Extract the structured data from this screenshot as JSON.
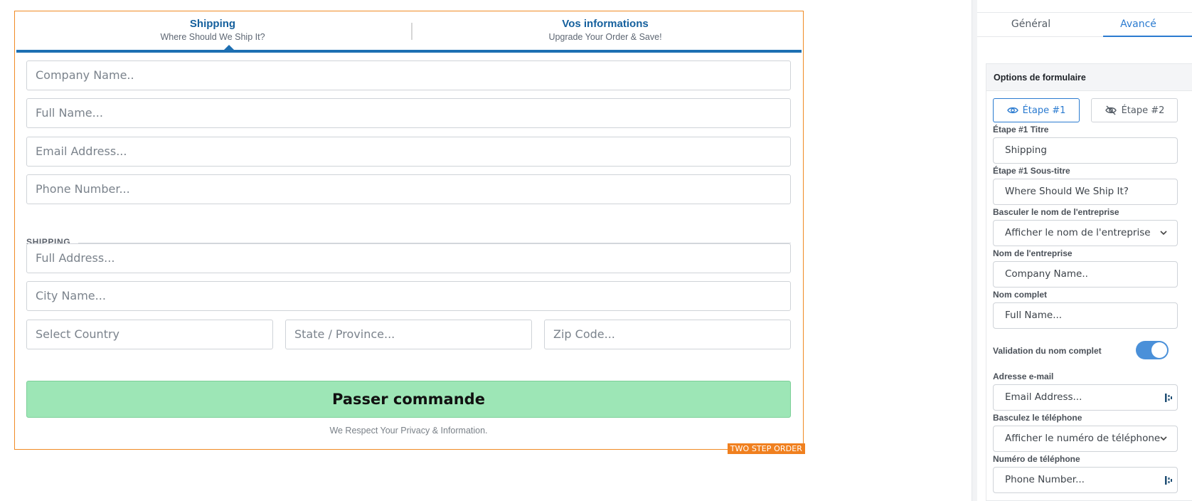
{
  "form": {
    "badge": "TWO STEP ORDER",
    "steps": [
      {
        "title": "Shipping",
        "subtitle": "Where Should We Ship It?"
      },
      {
        "title": "Vos informations",
        "subtitle": "Upgrade Your Order & Save!"
      }
    ],
    "fields": {
      "company": "Company Name..",
      "full_name": "Full Name...",
      "email": "Email Address...",
      "phone": "Phone Number...",
      "address": "Full Address...",
      "city": "City Name...",
      "country": "Select Country",
      "state": "State / Province...",
      "zip": "Zip Code..."
    },
    "section_label": "SHIPPING",
    "submit_label": "Passer commande",
    "privacy_text": "We Respect Your Privacy & Information.",
    "colors": {
      "accent": "#1d6fb2",
      "frame": "#f08a24",
      "submit": "#9de6b6"
    }
  },
  "panel": {
    "tabs": [
      "Général",
      "Avancé"
    ],
    "active_tab": "Avancé",
    "section_title": "Options de formulaire",
    "step_buttons": [
      {
        "label": "Étape #1",
        "icon": "eye-icon",
        "active": true
      },
      {
        "label": "Étape #2",
        "icon": "eye-slash-icon",
        "active": false
      }
    ],
    "step1_title": {
      "label": "Étape #1 Titre",
      "value": "Shipping"
    },
    "step1_subtitle": {
      "label": "Étape #1 Sous-titre",
      "value": "Where Should We Ship It?"
    },
    "company_toggle": {
      "label": "Basculer le nom de l'entreprise",
      "value": "Afficher le nom de l'entreprise"
    },
    "company_name": {
      "label": "Nom de l'entreprise",
      "value": "Company Name.."
    },
    "full_name": {
      "label": "Nom complet",
      "value": "Full Name..."
    },
    "full_name_validation": {
      "label": "Validation du nom complet",
      "enabled": true
    },
    "email": {
      "label": "Adresse e-mail",
      "value": "Email Address..."
    },
    "phone_toggle": {
      "label": "Basculez le téléphone",
      "value": "Afficher le numéro de téléphone"
    },
    "phone": {
      "label": "Numéro de téléphone",
      "value": "Phone Number..."
    },
    "colors": {
      "accent": "#2b7bd0",
      "toggle_on": "#4a90d9"
    }
  }
}
